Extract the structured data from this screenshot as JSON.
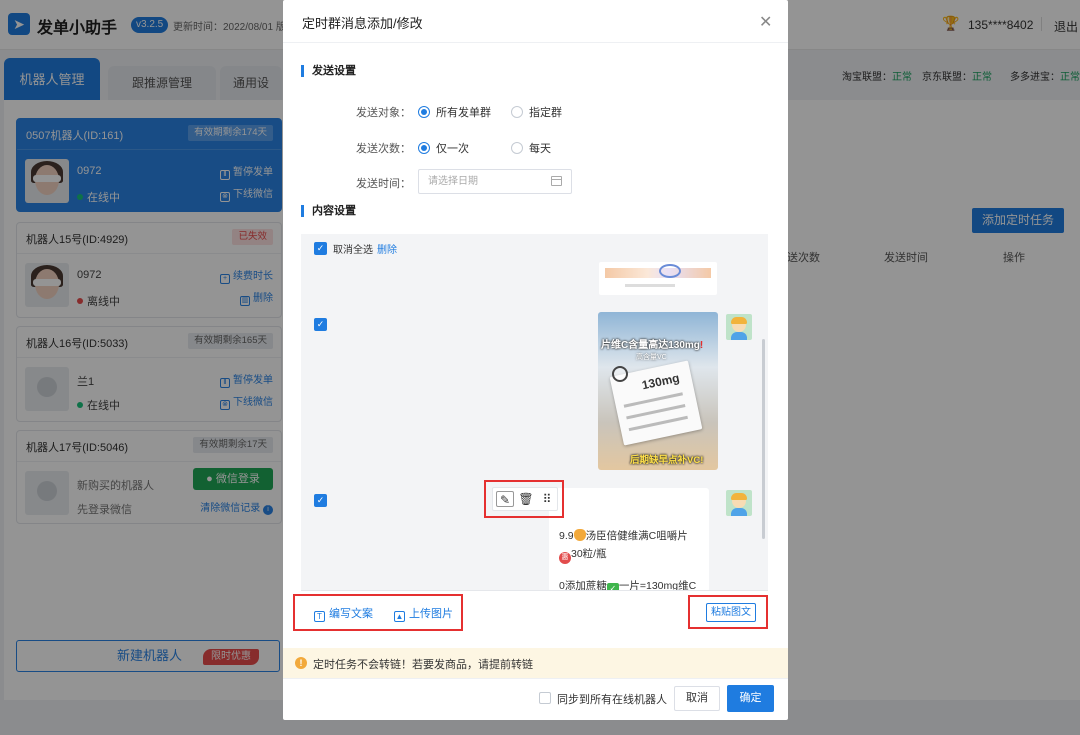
{
  "app": {
    "title": "发单小助手",
    "version": "v3.2.5",
    "update_time": "更新时间：2022/08/01 版",
    "account": "135****8402",
    "logout": "退出"
  },
  "tabs": [
    "机器人管理",
    "跟推源管理",
    "通用设"
  ],
  "status_strip": [
    {
      "label": "淘宝联盟：",
      "value": "正常"
    },
    {
      "label": "京东联盟：",
      "value": "正常"
    },
    {
      "label": "多多进宝：",
      "value": "正常"
    }
  ],
  "robots": [
    {
      "title": "0507机器人(ID:161)",
      "badge": "有效期剩余174天",
      "name": "0972",
      "status": "在线中",
      "action1": "暂停发单",
      "action2": "下线微信"
    },
    {
      "title": "机器人15号(ID:4929)",
      "badge": "已失效",
      "name": "0972",
      "status": "离线中",
      "action1": "续费时长",
      "action2": "删除"
    },
    {
      "title": "机器人16号(ID:5033)",
      "badge": "有效期剩余165天",
      "name": "兰1",
      "status": "在线中",
      "action1": "暂停发单",
      "action2": "下线微信"
    },
    {
      "title": "机器人17号(ID:5046)",
      "badge": "有效期剩余17天",
      "name": "新购买的机器人",
      "status": "先登录微信",
      "wechat_login": "微信登录",
      "clear_record": "清除微信记录"
    }
  ],
  "new_robot": {
    "label": "新建机器人",
    "promo": "限时优惠"
  },
  "main": {
    "add_task": "添加定时任务",
    "columns": [
      "送次数",
      "发送时间",
      "操作"
    ]
  },
  "modal": {
    "title": "定时群消息添加/修改",
    "send_section": "发送设置",
    "target_label": "发送对象：",
    "target_options": [
      "所有发单群",
      "指定群"
    ],
    "count_label": "发送次数：",
    "count_options": [
      "仅一次",
      "每天"
    ],
    "time_label": "发送时间：",
    "date_placeholder": "请选择日期",
    "content_section": "内容设置",
    "select_all": "取消全选",
    "delete": "删除",
    "image_text": {
      "headline": "片维C含量高达130mg",
      "sub": "高含量VC",
      "card_value": "130mg",
      "bottom": "后期缺早点补VC!"
    },
    "message_lines": [
      "9.9",
      "汤臣倍健维满C咀嚼片",
      "30粒/瓶",
      "0添加蔗糖",
      "一片=130mg维C"
    ],
    "write_copy": "编写文案",
    "upload_image": "上传图片",
    "paste": "粘贴图文",
    "notice": "定时任务不会转链！若要发商品，请提前转链",
    "sync_label": "同步到所有在线机器人",
    "cancel": "取消",
    "confirm": "确定"
  },
  "icons": [
    "plane-logo-icon",
    "trophy-icon",
    "close-icon",
    "calendar-icon",
    "edit-icon",
    "trash-icon",
    "drag-icon",
    "text-icon",
    "image-icon",
    "warning-icon"
  ]
}
